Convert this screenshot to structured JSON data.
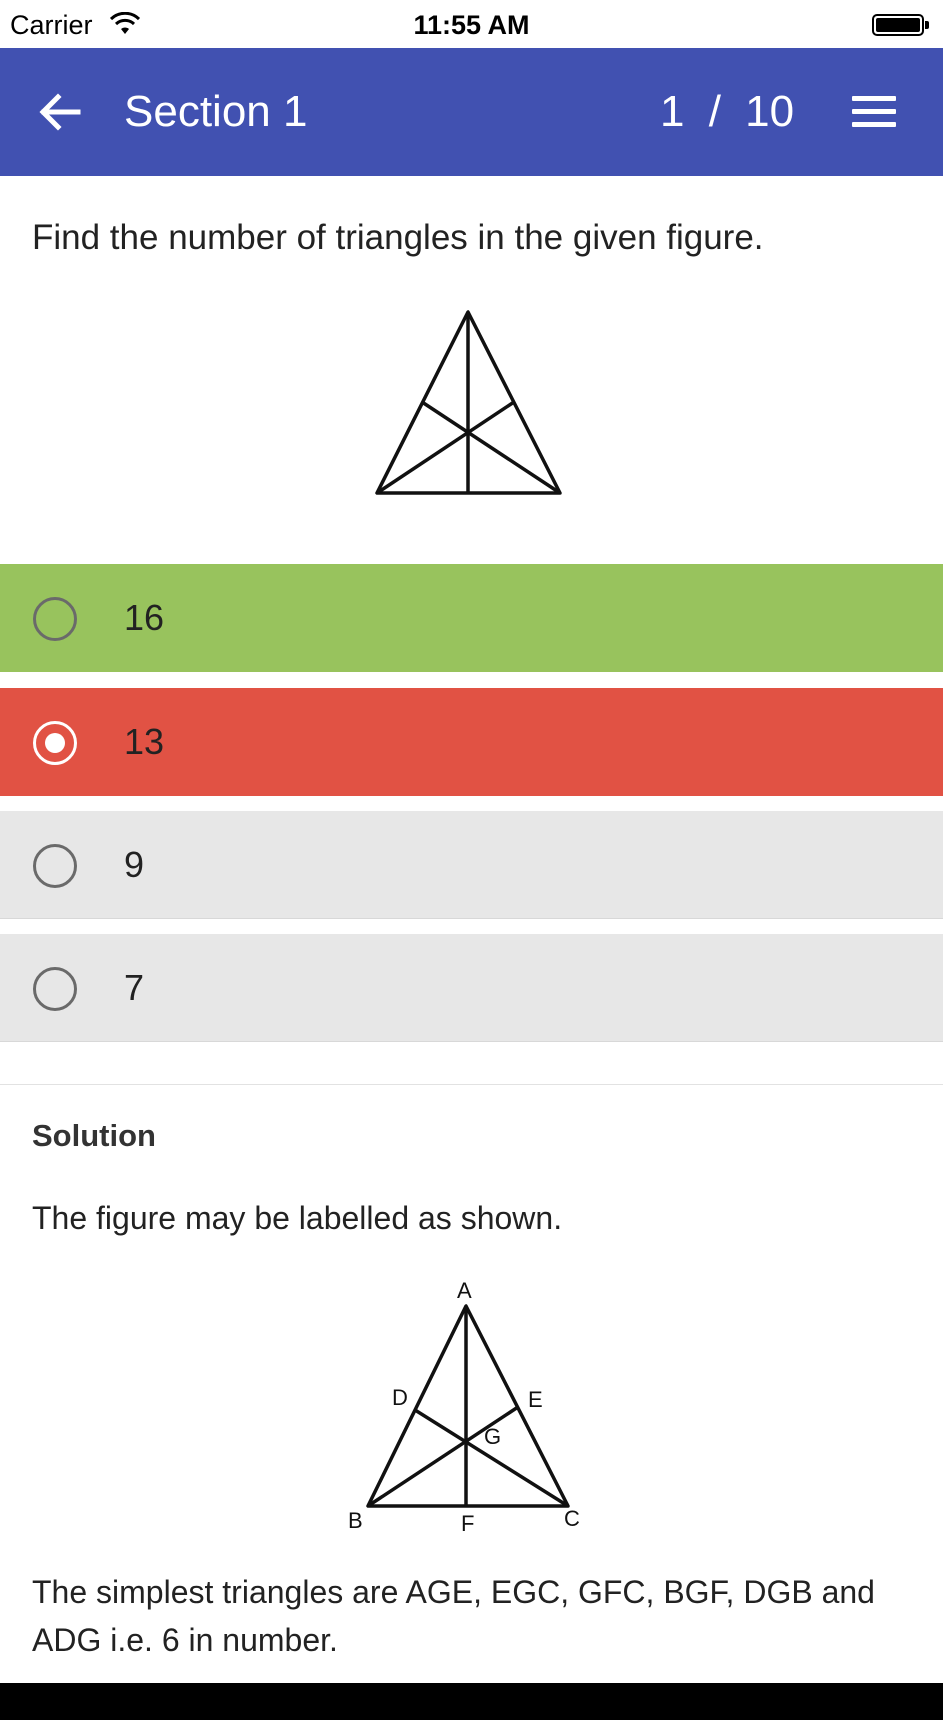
{
  "status_bar": {
    "carrier": "Carrier",
    "time": "11:55 AM"
  },
  "app_bar": {
    "title": "Section 1",
    "counter": "1 / 10",
    "back_icon": "arrow-left-icon",
    "menu_icon": "hamburger-menu-icon",
    "background": "#4151b1"
  },
  "question": {
    "text": "Find the number of triangles in the given figure."
  },
  "options": [
    {
      "label": "16",
      "state": "correct",
      "selected": false,
      "color": "#98c35d"
    },
    {
      "label": "13",
      "state": "wrong",
      "selected": true,
      "color": "#e15244"
    },
    {
      "label": "9",
      "state": "neutral",
      "selected": false,
      "color": "#e7e7e7"
    },
    {
      "label": "7",
      "state": "neutral",
      "selected": false,
      "color": "#e7e7e7"
    }
  ],
  "solution": {
    "heading": "Solution",
    "intro": "The figure may be labelled as shown.",
    "figure_labels": {
      "a": "A",
      "b": "B",
      "c": "C",
      "d": "D",
      "e": "E",
      "f": "F",
      "g": "G"
    },
    "explanation": "The simplest triangles are AGE, EGC, GFC, BGF, DGB and ADG i.e. 6 in number."
  }
}
